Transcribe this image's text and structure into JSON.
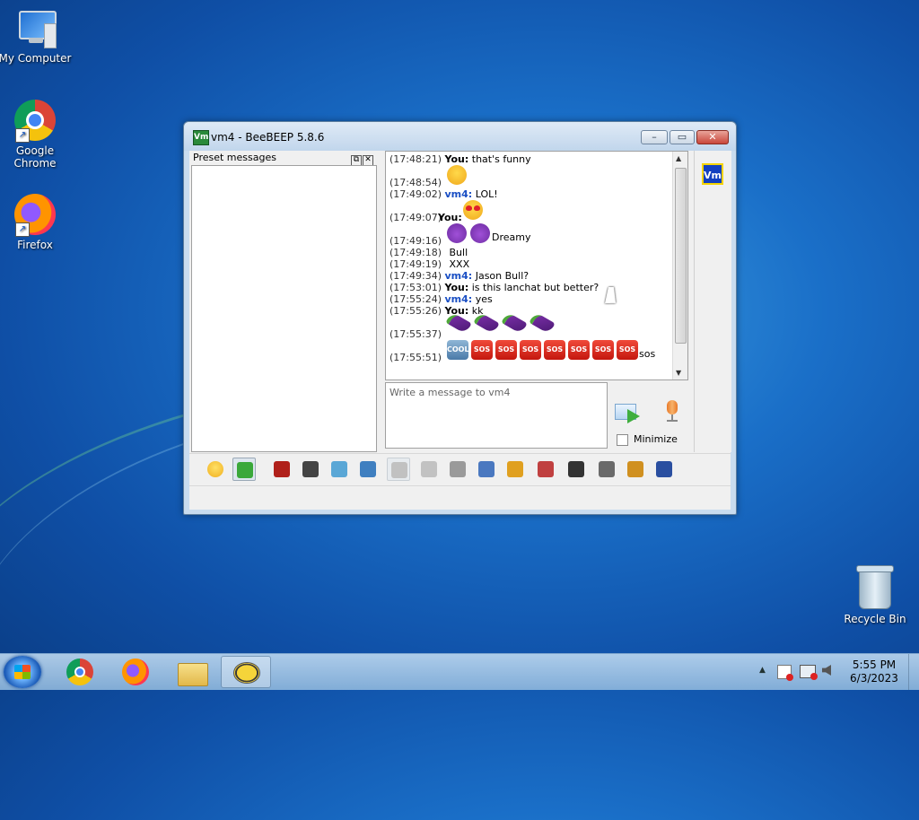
{
  "desktop": {
    "icons": [
      {
        "label": "My Computer"
      },
      {
        "label": "Google Chrome"
      },
      {
        "label": "Firefox"
      },
      {
        "label": "Recycle Bin"
      }
    ]
  },
  "window": {
    "title": "vm4 - BeeBEEP 5.8.6",
    "app_icon_text": "Vm",
    "buttons": {
      "minimize": "–",
      "maximize": "▭",
      "close": "✕"
    }
  },
  "preset": {
    "title": "Preset messages",
    "float_glyph": "⧉",
    "close_glyph": "✕"
  },
  "chat": {
    "messages": [
      {
        "time": "(17:48:21)",
        "sender": "You",
        "sender_type": "you",
        "text": "that's funny"
      },
      {
        "time": "(17:48:54)",
        "sender": "",
        "sender_type": "none",
        "emoji": "sweat-smile",
        "text": ""
      },
      {
        "time": "(17:49:02)",
        "sender": "vm4",
        "sender_type": "vm",
        "text": "LOL!"
      },
      {
        "time": "(17:49:07)",
        "sender": "You",
        "sender_type": "you",
        "emoji": "heart-eyes",
        "text": ""
      },
      {
        "time": "(17:49:16)",
        "sender": "",
        "sender_type": "none",
        "emoji": "devils",
        "text": "Dreamy"
      },
      {
        "time": "(17:49:18)",
        "sender": "",
        "sender_type": "none",
        "text": "Bull"
      },
      {
        "time": "(17:49:19)",
        "sender": "",
        "sender_type": "none",
        "text": "XXX"
      },
      {
        "time": "(17:49:34)",
        "sender": "vm4",
        "sender_type": "vm",
        "text": "Jason Bull?"
      },
      {
        "time": "(17:53:01)",
        "sender": "You",
        "sender_type": "you",
        "text": "is this lanchat but better?"
      },
      {
        "time": "(17:55:24)",
        "sender": "vm4",
        "sender_type": "vm",
        "text": "yes"
      },
      {
        "time": "(17:55:26)",
        "sender": "You",
        "sender_type": "you",
        "text": "kk"
      },
      {
        "time": "(17:55:37)",
        "sender": "",
        "sender_type": "none",
        "emoji": "eggplants",
        "text": ""
      },
      {
        "time": "(17:55:51)",
        "sender": "",
        "sender_type": "none",
        "emoji": "sos",
        "text": "sos"
      }
    ],
    "badge_cool": "COOL",
    "badge_sos": "SOS",
    "sender_sep": ":"
  },
  "compose": {
    "placeholder": "Write a message to vm4",
    "minimize_label": "Minimize"
  },
  "sidebar": {
    "user_icon_text": "Vm"
  },
  "toolbar": {
    "icons": [
      "emoticons-icon",
      "send-file-icon",
      "font-icon",
      "color-icon",
      "filter-icon",
      "settings-icon",
      "spellcheck-icon",
      "word-completer-icon",
      "sound-icon",
      "save-chat-icon",
      "share-folder-icon",
      "code-icon",
      "screenshot-icon",
      "clear-chat-icon",
      "edit-icon",
      "save-icon"
    ]
  },
  "taskbar": {
    "time": "5:55 PM",
    "date": "6/3/2023",
    "tray_up": "▲"
  },
  "colors": {
    "you_sender": "#000000",
    "vm_sender": "#1a4fc4",
    "sos_badge": "#d0201a"
  }
}
